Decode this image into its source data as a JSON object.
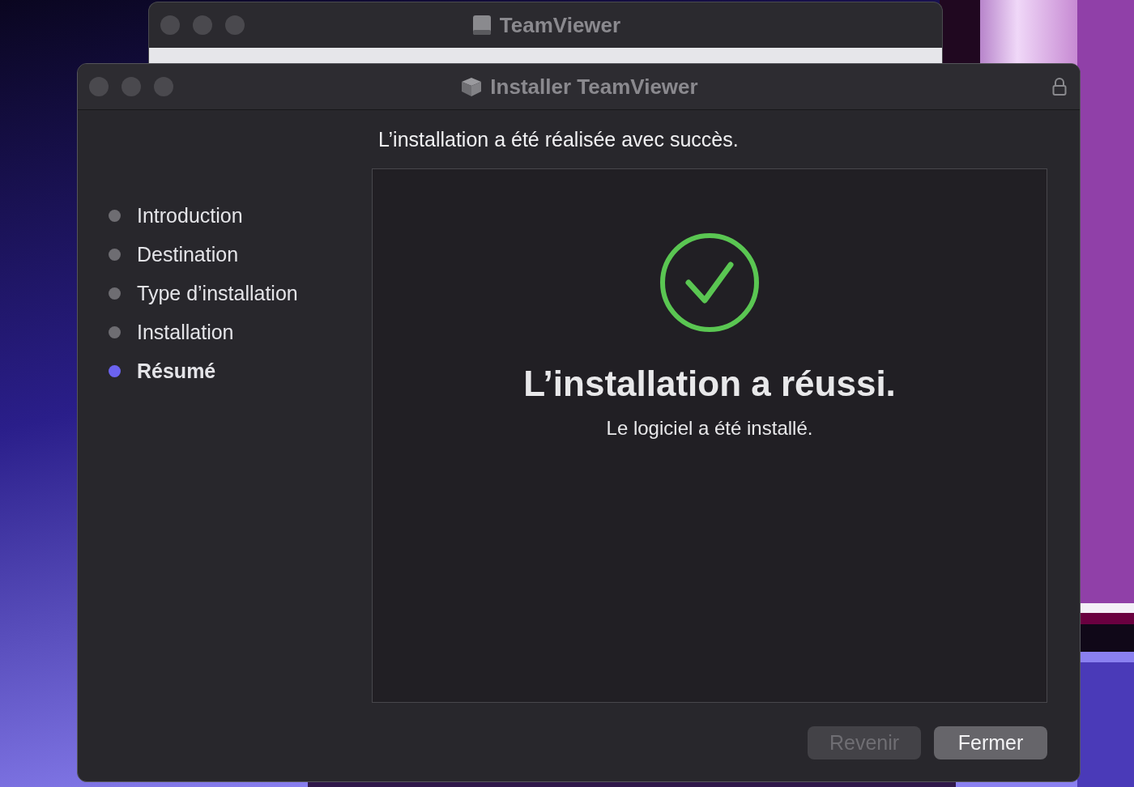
{
  "background_window": {
    "title": "TeamViewer"
  },
  "window": {
    "title": "Installer TeamViewer"
  },
  "steps": [
    {
      "label": "Introduction",
      "selected": false
    },
    {
      "label": "Destination",
      "selected": false
    },
    {
      "label": "Type d’installation",
      "selected": false
    },
    {
      "label": "Installation",
      "selected": false
    },
    {
      "label": "Résumé",
      "selected": true
    }
  ],
  "heading": "L’installation a été réalisée avec succès.",
  "result": {
    "title": "L’installation a réussi.",
    "message": "Le logiciel a été installé."
  },
  "buttons": [
    {
      "label": "Revenir",
      "disabled": true
    },
    {
      "label": "Fermer",
      "disabled": false
    }
  ]
}
